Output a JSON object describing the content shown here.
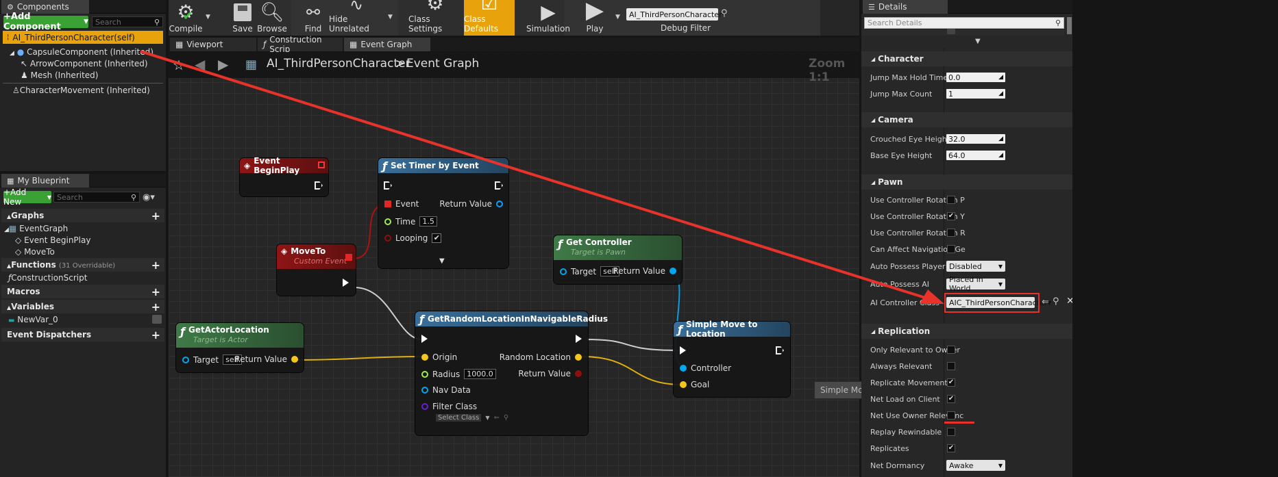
{
  "components": {
    "tab": "Components",
    "add_btn": "+Add Component",
    "search_ph": "Search",
    "selected": "AI_ThirdPersonCharacter(self)",
    "tree": [
      "CapsuleComponent (Inherited)",
      "ArrowComponent (Inherited)",
      "Mesh (Inherited)",
      "CharacterMovement (Inherited)"
    ]
  },
  "toolbar": {
    "buttons": [
      "Compile",
      "Save",
      "Browse",
      "Find",
      "Hide Unrelated",
      "Class Settings",
      "Class Defaults",
      "Simulation",
      "Play"
    ],
    "debug_select": "AI_ThirdPersonCharacter",
    "debug_label": "Debug Filter"
  },
  "graph_tabs": [
    "Viewport",
    "Construction Scrip",
    "Event Graph"
  ],
  "breadcrumb": {
    "root": "AI_ThirdPersonCharacter",
    "sep": ">",
    "current": "Event Graph",
    "zoom": "Zoom 1:1"
  },
  "my_blueprint": {
    "tab": "My Blueprint",
    "add_btn": "+Add New",
    "search_ph": "Search",
    "graphs": "Graphs",
    "event_graph": "EventGraph",
    "events": [
      "Event BeginPlay",
      "MoveTo"
    ],
    "functions": "Functions",
    "functions_note": "(31 Overridable)",
    "construction": "ConstructionScript",
    "macros": "Macros",
    "variables": "Variables",
    "var0": "NewVar_0",
    "dispatchers": "Event Dispatchers"
  },
  "nodes": {
    "begin_play": {
      "title": "Event BeginPlay"
    },
    "set_timer": {
      "title": "Set Timer by Event",
      "event": "Event",
      "return": "Return Value",
      "time": "Time",
      "time_val": "1.5",
      "looping": "Looping"
    },
    "move_to": {
      "title": "MoveTo",
      "sub": "Custom Event"
    },
    "get_controller": {
      "title": "Get Controller",
      "sub": "Target is Pawn",
      "target": "Target",
      "self": "self",
      "return": "Return Value"
    },
    "get_actor_loc": {
      "title": "GetActorLocation",
      "sub": "Target is Actor",
      "target": "Target",
      "self": "self",
      "return": "Return Value"
    },
    "random_loc": {
      "title": "GetRandomLocationInNavigableRadius",
      "origin": "Origin",
      "random": "Random Location",
      "radius": "Radius",
      "radius_val": "1000.0",
      "return": "Return Value",
      "nav": "Nav Data",
      "filter": "Filter Class",
      "select": "Select Class"
    },
    "simple_move": {
      "title": "Simple Move to Location",
      "controller": "Controller",
      "goal": "Goal"
    }
  },
  "tooltip": "Simple Move to Location",
  "details": {
    "tab": "Details",
    "search_ph": "Search Details",
    "character": "Character",
    "jump_hold": "Jump Max Hold Time",
    "jump_hold_val": "0.0",
    "jump_count": "Jump Max Count",
    "jump_count_val": "1",
    "camera": "Camera",
    "crouched": "Crouched Eye Height",
    "crouched_val": "32.0",
    "base_eye": "Base Eye Height",
    "base_eye_val": "64.0",
    "pawn": "Pawn",
    "ucr_p": "Use Controller Rotation P",
    "ucr_y": "Use Controller Rotation Y",
    "ucr_r": "Use Controller Rotation R",
    "can_affect": "Can Affect Navigation Ge",
    "auto_player": "Auto Possess Player",
    "auto_player_val": "Disabled",
    "auto_ai": "Auto Possess AI",
    "auto_ai_val": "Placed in World",
    "ai_class": "AI Controller Class",
    "ai_class_val": "AIC_ThirdPersonCharacter",
    "replication": "Replication",
    "only_owner": "Only Relevant to Owner",
    "always": "Always Relevant",
    "replicate_mv": "Replicate Movement",
    "net_load": "Net Load on Client",
    "net_owner": "Net Use Owner Relevanc",
    "replay": "Replay Rewindable",
    "replicates": "Replicates",
    "dormancy": "Net Dormancy",
    "dormancy_val": "Awake"
  },
  "colors": {
    "accent_orange": "#e8a20c",
    "annotation_red": "#e8332b",
    "exec_white": "#ffffff",
    "vector_yellow": "#f4c51b",
    "object_blue": "#00a8f0",
    "bool_red": "#8f0f0f",
    "float_green": "#9ef04a"
  }
}
